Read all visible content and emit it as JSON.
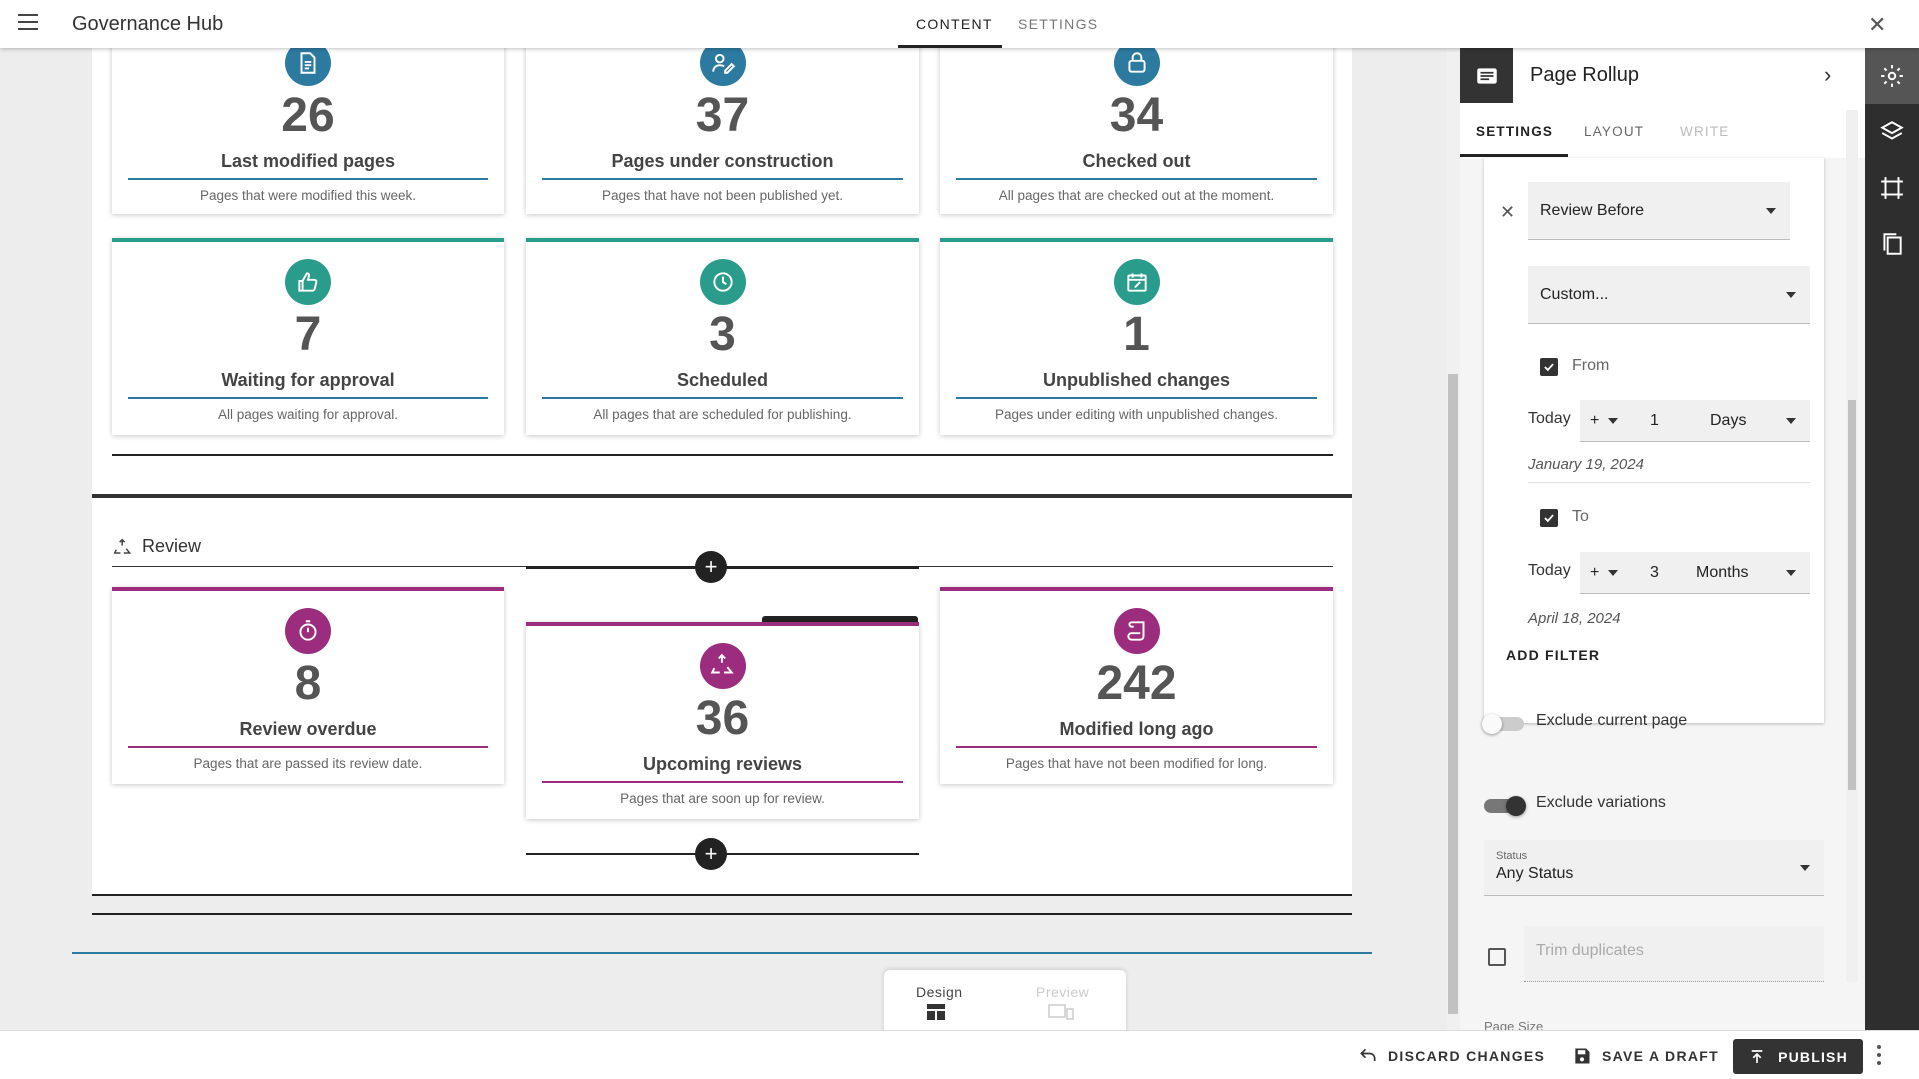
{
  "header": {
    "title": "Governance Hub",
    "tabs": [
      {
        "label": "CONTENT",
        "active": true
      },
      {
        "label": "SETTINGS",
        "active": false
      }
    ]
  },
  "cards_row1": [
    {
      "number": "26",
      "label": "Last modified pages",
      "description": "Pages that were modified this week.",
      "icon": "document-icon",
      "color": "#2d7aa0"
    },
    {
      "number": "37",
      "label": "Pages under construction",
      "description": "Pages that have not been published yet.",
      "icon": "edit-user-icon",
      "color": "#2d7aa0"
    },
    {
      "number": "34",
      "label": "Checked out",
      "description": "All pages that are checked out at the moment.",
      "icon": "lock-icon",
      "color": "#2d7aa0"
    }
  ],
  "cards_row2": [
    {
      "number": "7",
      "label": "Waiting for approval",
      "description": "All pages waiting for approval.",
      "icon": "thumbs-up-icon",
      "color": "#2a9c8c"
    },
    {
      "number": "3",
      "label": "Scheduled",
      "description": "All pages that are scheduled for publishing.",
      "icon": "clock-icon",
      "color": "#2a9c8c"
    },
    {
      "number": "1",
      "label": "Unpublished changes",
      "description": "Pages under editing with unpublished changes.",
      "icon": "calendar-edit-icon",
      "color": "#2a9c8c"
    }
  ],
  "review_section": {
    "title": "Review",
    "cards": [
      {
        "number": "8",
        "label": "Review overdue",
        "description": "Pages that are passed its review date.",
        "icon": "stopwatch-icon",
        "color": "#9c2d7e"
      },
      {
        "number": "36",
        "label": "Upcoming reviews",
        "description": "Pages that are soon up for review.",
        "icon": "recycle-icon",
        "color": "#9c2d7e"
      },
      {
        "number": "242",
        "label": "Modified long ago",
        "description": "Pages that have not been modified for long.",
        "icon": "scroll-icon",
        "color": "#9c2d7e"
      }
    ]
  },
  "view_switch": {
    "design": "Design",
    "preview": "Preview"
  },
  "panel": {
    "title": "Page Rollup",
    "tabs": [
      {
        "label": "SETTINGS"
      },
      {
        "label": "LAYOUT"
      },
      {
        "label": "WRITE"
      }
    ],
    "filter": {
      "field": "Review Before",
      "mode": "Custom...",
      "from_label": "From",
      "to_label": "To",
      "today_label": "Today",
      "from_sign": "+",
      "from_value": "1",
      "from_unit": "Days",
      "from_date": "January 19, 2024",
      "to_sign": "+",
      "to_value": "3",
      "to_unit": "Months",
      "to_date": "April 18, 2024",
      "add_filter": "ADD FILTER"
    },
    "exclude_current": "Exclude current page",
    "exclude_variations": "Exclude variations",
    "status_label": "Status",
    "status_value": "Any Status",
    "trim_duplicates": "Trim duplicates",
    "page_size_partial": "Page Size"
  },
  "footer": {
    "discard": "DISCARD CHANGES",
    "save": "SAVE A DRAFT",
    "publish": "PUBLISH"
  }
}
